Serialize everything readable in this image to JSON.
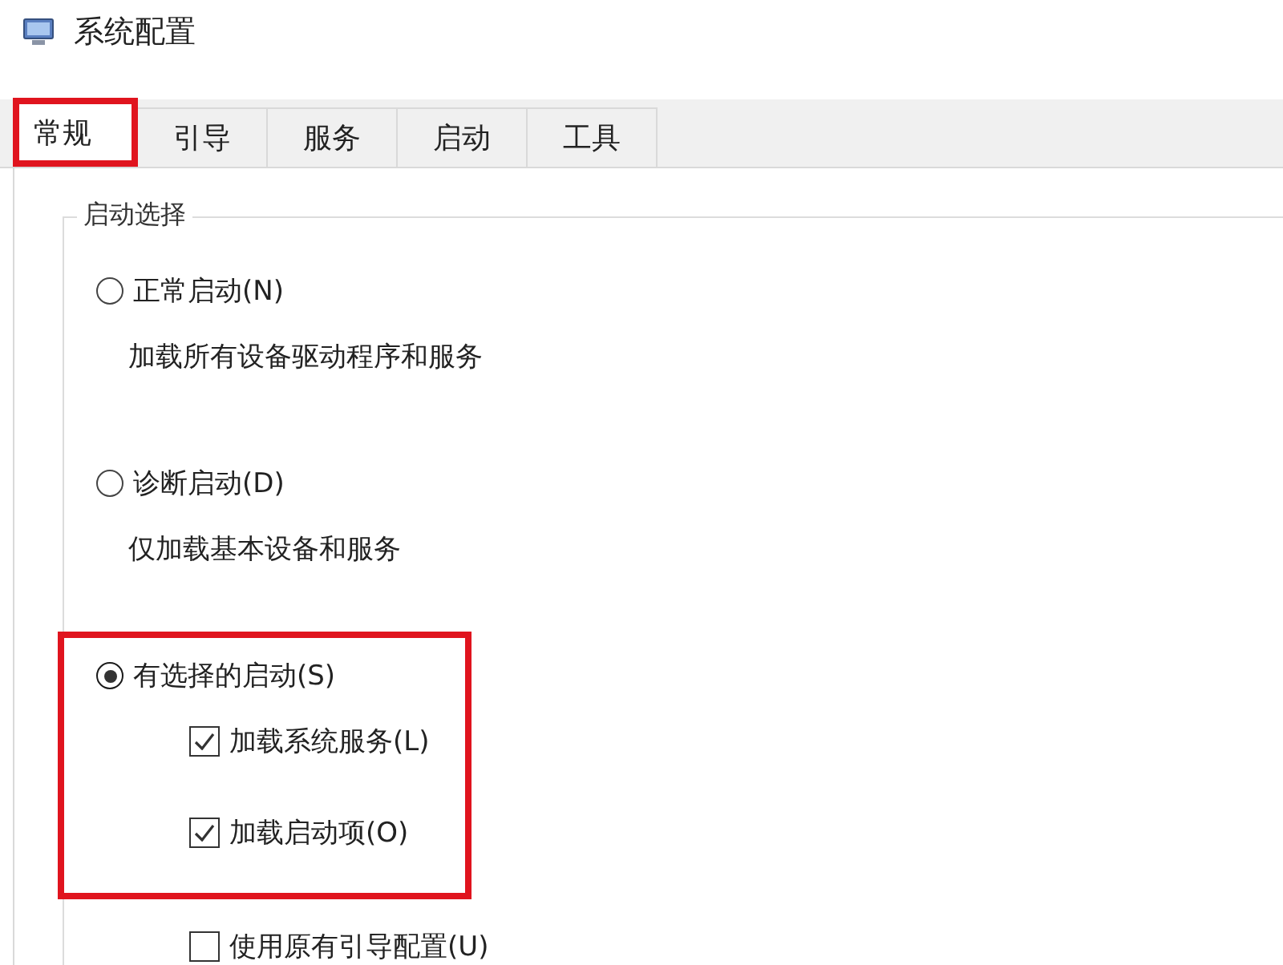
{
  "window": {
    "title": "系统配置"
  },
  "tabs": [
    {
      "label": "常规",
      "selected": true,
      "highlighted": true
    },
    {
      "label": "引导",
      "selected": false,
      "highlighted": false
    },
    {
      "label": "服务",
      "selected": false,
      "highlighted": false
    },
    {
      "label": "启动",
      "selected": false,
      "highlighted": false
    },
    {
      "label": "工具",
      "selected": false,
      "highlighted": false
    }
  ],
  "startup_selection": {
    "title": "启动选择",
    "options": [
      {
        "label": "正常启动(N)",
        "selected": false,
        "description": "加载所有设备驱动程序和服务",
        "highlighted": false
      },
      {
        "label": "诊断启动(D)",
        "selected": false,
        "description": "仅加载基本设备和服务",
        "highlighted": false
      },
      {
        "label": "有选择的启动(S)",
        "selected": true,
        "highlighted": true,
        "checkboxes": [
          {
            "label": "加载系统服务(L)",
            "checked": true,
            "highlighted": true
          },
          {
            "label": "加载启动项(O)",
            "checked": true,
            "highlighted": true
          },
          {
            "label": "使用原有引导配置(U)",
            "checked": false,
            "highlighted": false
          }
        ]
      }
    ]
  }
}
